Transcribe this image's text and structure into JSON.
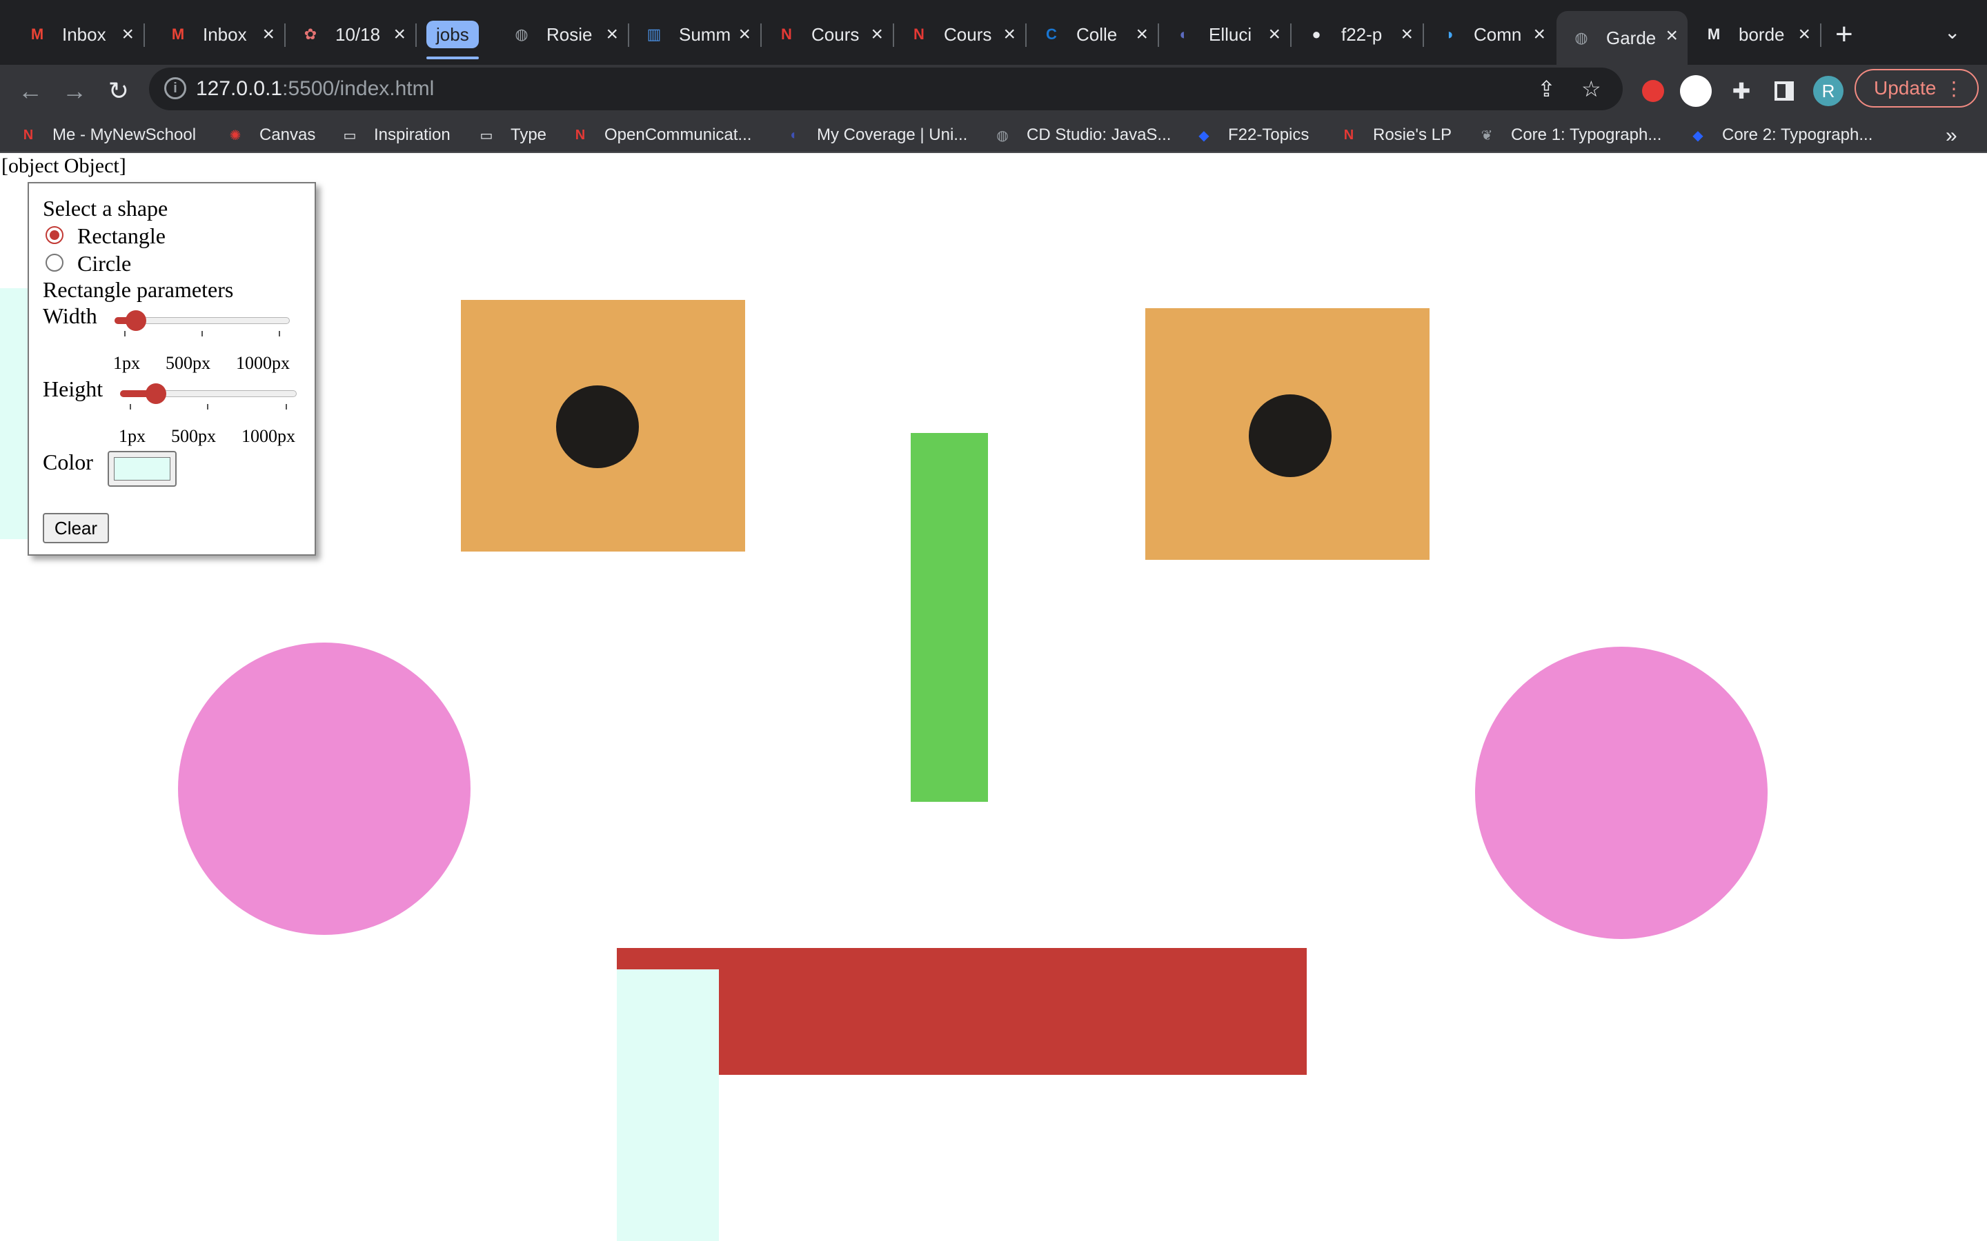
{
  "browser": {
    "tabs": [
      {
        "title": "Inbox",
        "favicon": "gmail-icon",
        "glyph": "M",
        "color": "#ea4335"
      },
      {
        "title": "Inbox",
        "favicon": "gmail-icon",
        "glyph": "M",
        "color": "#ea4335"
      },
      {
        "title": "10/18",
        "favicon": "flower-icon",
        "glyph": "✿",
        "color": "#e57373"
      },
      {
        "title": "Rosie",
        "favicon": "globe-icon",
        "glyph": "◍",
        "color": "#9aa0a6"
      },
      {
        "title": "Summ",
        "favicon": "chart-icon",
        "glyph": "▥",
        "color": "#4a90e2"
      },
      {
        "title": "Cours",
        "favicon": "newschool-icon",
        "glyph": "N",
        "color": "#e53935"
      },
      {
        "title": "Cours",
        "favicon": "newschool-icon",
        "glyph": "N",
        "color": "#e53935"
      },
      {
        "title": "Colle",
        "favicon": "c-icon",
        "glyph": "C",
        "color": "#1976d2"
      },
      {
        "title": "Elluci",
        "favicon": "ellucian-icon",
        "glyph": "◐",
        "color": "#5c6bc0"
      },
      {
        "title": "f22-p",
        "favicon": "github-icon",
        "glyph": "●",
        "color": "#e8eaed"
      },
      {
        "title": "Comn",
        "favicon": "comm-icon",
        "glyph": "◑",
        "color": "#42a5f5"
      },
      {
        "title": "Garde",
        "favicon": "globe-icon",
        "glyph": "◍",
        "color": "#9aa0a6"
      },
      {
        "title": "borde",
        "favicon": "mdn-icon",
        "glyph": "M",
        "color": "#e8eaed"
      }
    ],
    "active_tab_index": 11,
    "tab_group_label": "jobs",
    "url_host": "127.0.0.1",
    "url_rest": ":5500/index.html",
    "update_label": "Update",
    "profile_initial": "R",
    "bookmarks": [
      {
        "label": "Me - MyNewSchool",
        "icon": "newschool-icon",
        "glyph": "N",
        "color": "#e53935"
      },
      {
        "label": "Canvas",
        "icon": "canvas-icon",
        "glyph": "✺",
        "color": "#e53935"
      },
      {
        "label": "Inspiration",
        "icon": "folder-icon",
        "glyph": "▭",
        "color": "#e8eaed"
      },
      {
        "label": "Type",
        "icon": "folder-icon",
        "glyph": "▭",
        "color": "#e8eaed"
      },
      {
        "label": "OpenCommunicat...",
        "icon": "newschool-icon",
        "glyph": "N",
        "color": "#e53935"
      },
      {
        "label": "My Coverage | Uni...",
        "icon": "shield-icon",
        "glyph": "◖",
        "color": "#3f51b5"
      },
      {
        "label": "CD Studio: JavaS...",
        "icon": "globe-icon",
        "glyph": "◍",
        "color": "#9aa0a6"
      },
      {
        "label": "F22-Topics",
        "icon": "layers-icon",
        "glyph": "◆",
        "color": "#2962ff"
      },
      {
        "label": "Rosie's LP",
        "icon": "new-icon",
        "glyph": "N",
        "color": "#e53935"
      },
      {
        "label": "Core 1: Typograph...",
        "icon": "bird-icon",
        "glyph": "❦",
        "color": "#9aa0a6"
      },
      {
        "label": "Core 2: Typograph...",
        "icon": "layers-icon",
        "glyph": "◆",
        "color": "#2962ff"
      }
    ]
  },
  "page": {
    "debug_text": "[object Object]",
    "controls": {
      "select_label": "Select a shape",
      "options": [
        "Rectangle",
        "Circle"
      ],
      "selected_option": "Rectangle",
      "params_title": "Rectangle parameters",
      "width_label": "Width",
      "width_ticks": [
        "1px",
        "500px",
        "1000px"
      ],
      "width_value_fraction": 0.12,
      "height_label": "Height",
      "height_ticks": [
        "1px",
        "500px",
        "1000px"
      ],
      "height_value_fraction": 0.2,
      "color_label": "Color",
      "color_value": "#e0fdf6",
      "clear_label": "Clear"
    },
    "shape_colors": {
      "orange": "#e5a95a",
      "pupil": "#1e1c1a",
      "green": "#66cc55",
      "pink": "#ee8dd5",
      "red": "#c23a35",
      "mint": "#e0fdf6"
    }
  }
}
